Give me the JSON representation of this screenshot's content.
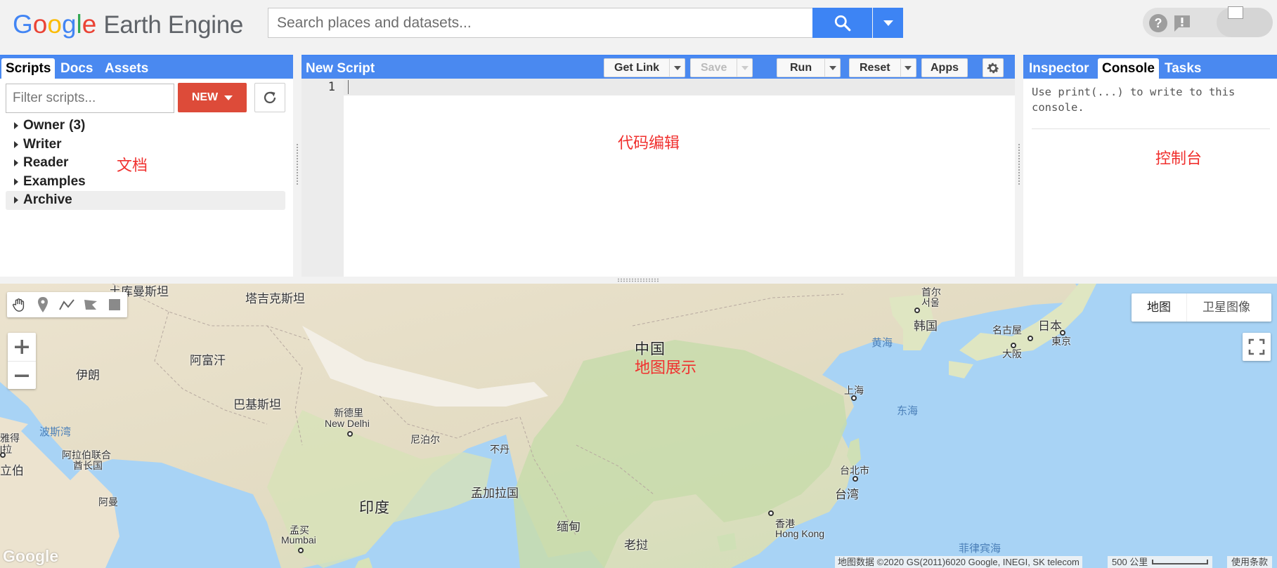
{
  "header": {
    "logo_letters": [
      "G",
      "o",
      "o",
      "g",
      "l",
      "e"
    ],
    "logo_colors": [
      "#4285f4",
      "#ea4335",
      "#fbbc05",
      "#4285f4",
      "#34a853",
      "#ea4335"
    ],
    "product": "Earth Engine",
    "search_placeholder": "Search places and datasets..."
  },
  "left_panel": {
    "tabs": [
      "Scripts",
      "Docs",
      "Assets"
    ],
    "active_tab": "Scripts",
    "filter_placeholder": "Filter scripts...",
    "new_label": "NEW",
    "tree": [
      {
        "label": "Owner",
        "count": "(3)"
      },
      {
        "label": "Writer",
        "count": ""
      },
      {
        "label": "Reader",
        "count": ""
      },
      {
        "label": "Examples",
        "count": ""
      },
      {
        "label": "Archive",
        "count": ""
      }
    ],
    "annotation": "文档"
  },
  "editor": {
    "title": "New Script",
    "buttons": {
      "get_link": "Get Link",
      "save": "Save",
      "run": "Run",
      "reset": "Reset",
      "apps": "Apps"
    },
    "line_number": "1",
    "annotation": "代码编辑"
  },
  "right_panel": {
    "tabs": [
      "Inspector",
      "Console",
      "Tasks"
    ],
    "active_tab": "Console",
    "console_message": "Use print(...) to write to this console.",
    "annotation": "控制台"
  },
  "map": {
    "annotation": "地图展示",
    "map_types": [
      "地图",
      "卫星图像"
    ],
    "labels": {
      "turkmenistan": "土库曼斯坦",
      "tajikistan": "塔吉克斯坦",
      "afghanistan": "阿富汗",
      "iran": "伊朗",
      "pakistan": "巴基斯坦",
      "china": "中国",
      "new_delhi_cn": "新德里",
      "new_delhi_en": "New Delhi",
      "nepal": "尼泊尔",
      "bhutan": "不丹",
      "bangladesh": "孟加拉国",
      "india": "印度",
      "myanmar": "缅甸",
      "laos": "老挝",
      "mumbai_cn": "孟买",
      "mumbai_en": "Mumbai",
      "hong_kong_cn": "香港",
      "hong_kong_en": "Hong Kong",
      "taipei": "台北市",
      "taiwan": "台湾",
      "shanghai": "上海",
      "east_sea": "东海",
      "yellow_sea": "黄海",
      "seoul_cn": "首尔",
      "seoul_kr": "서울",
      "korea": "韩国",
      "japan": "日本",
      "tokyo": "東京",
      "nagoya": "名古屋",
      "osaka": "大阪",
      "persian_gulf": "波斯湾",
      "uae_1": "阿拉伯联合",
      "uae_2": "酋长国",
      "saudi_1": "雅得",
      "saudi_2": "l拉",
      "saudi_3": "立伯",
      "oman": "阿曼",
      "philippine_sea": "菲律宾海"
    },
    "attribution": "地图数据 ©2020 GS(2011)6020 Google, INEGI, SK telecom",
    "scale_label": "500 公里",
    "terms": "使用条款",
    "google_mark": "Google"
  }
}
